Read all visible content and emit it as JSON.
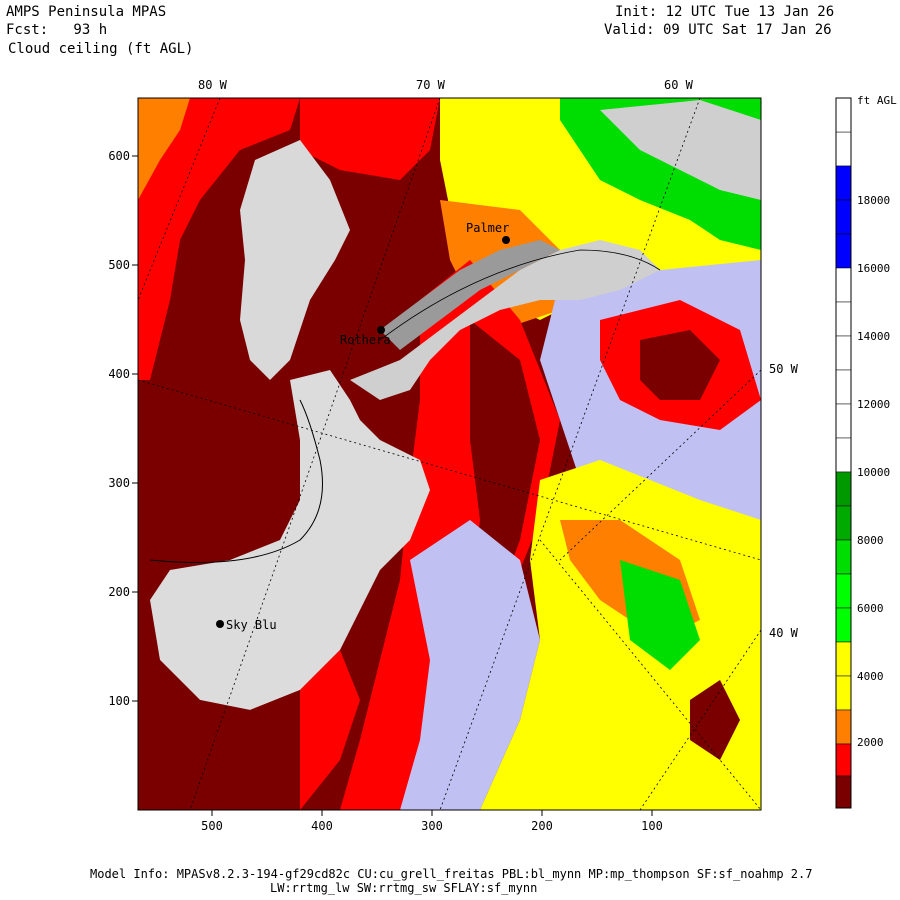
{
  "header": {
    "title": "AMPS Peninsula MPAS",
    "forecast": "Fcst:   93 h",
    "field": "Cloud ceiling (ft AGL)",
    "init": "Init: 12 UTC Tue 13 Jan 26",
    "valid": "Valid: 09 UTC Sat 17 Jan 26"
  },
  "map": {
    "top_lon_labels": [
      "80 W",
      "70 W",
      "60 W"
    ],
    "right_lon_labels": [
      "50 W",
      "40 W"
    ],
    "y_ticks": [
      "600",
      "500",
      "400",
      "300",
      "200",
      "100"
    ],
    "x_ticks": [
      "500",
      "400",
      "300",
      "200",
      "100"
    ],
    "stations": [
      "Palmer",
      "Rothera",
      "Sky Blu"
    ]
  },
  "colorbar": {
    "unit": "ft AGL",
    "tick_labels": [
      "18000",
      "16000",
      "14000",
      "12000",
      "10000",
      "8000",
      "6000",
      "4000",
      "2000"
    ],
    "colors": [
      "#7a0000",
      "#ff0000",
      "#ff7f00",
      "#ffff00",
      "#ffff00",
      "#00ff00",
      "#00ff00",
      "#00aa00",
      "#009900",
      "#ffffff",
      "#ffffff",
      "#ffffff",
      "#ffffff",
      "#0000ff",
      "#0000cc",
      "#ffffff"
    ]
  },
  "footer": {
    "line1": "Model Info: MPASv8.2.3-194-gf29cd82c CU:cu_grell_freitas PBL:bl_mynn MP:mp_thompson SF:sf_noahmp 2.7",
    "line2": "LW:rrtmg_lw SW:rrtmg_sw SFLAY:sf_mynn"
  }
}
